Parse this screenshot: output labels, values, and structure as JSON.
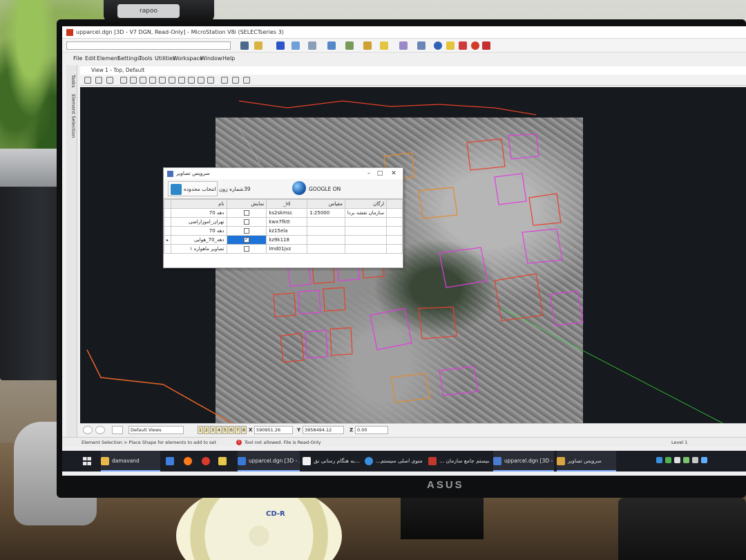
{
  "window": {
    "title": "upparcel.dgn [3D - V7 DGN, Read-Only] - MicroStation V8i (SELECTseries 3)"
  },
  "webcam": {
    "brand": "rapoo"
  },
  "menu": [
    "File",
    "Edit",
    "Element",
    "Settings",
    "Tools",
    "Utilities",
    "Workspace",
    "Window",
    "Help"
  ],
  "dock": {
    "tabs": [
      "Tasks",
      "Element Selection"
    ]
  },
  "view": {
    "title": "View 1 - Top, Default"
  },
  "dialog": {
    "title": "سرویس تصاویر",
    "select_button": "انتخاب محدوده",
    "zone_label": "شماره زون",
    "zone_value": "39",
    "google_label": "GOOGLE ON",
    "columns": [
      "نام",
      "نمایش",
      "_id",
      "مقیاس",
      "ارگان"
    ],
    "rows": [
      {
        "name": "دهه 70",
        "show": false,
        "id": "ks2skmsc",
        "scale": "1:25000",
        "org": "سازمان نقشه بردا",
        "selected": false
      },
      {
        "name": "تهران_اموزاراضی",
        "show": false,
        "id": "kwx7fktt",
        "scale": "",
        "org": "",
        "selected": false
      },
      {
        "name": "دهه 70",
        "show": false,
        "id": "kz15ela",
        "scale": "",
        "org": "",
        "selected": false
      },
      {
        "name": "دهه_70_هوایی",
        "show": true,
        "id": "kz9k118",
        "scale": "",
        "org": "",
        "selected": true
      },
      {
        "name": "تصاویر ماهواره ۱",
        "show": false,
        "id": "lmd01jvz",
        "scale": "",
        "org": "",
        "selected": false
      }
    ]
  },
  "viewbar": {
    "views_combo": "Default Views",
    "view_numbers": [
      "1",
      "2",
      "3",
      "4",
      "5",
      "6",
      "7",
      "8"
    ],
    "x_label": "X",
    "x_value": "590951.26",
    "y_label": "Y",
    "y_value": "3958494.12",
    "z_label": "Z",
    "z_value": "0.00"
  },
  "statusbar": {
    "prompt": "Element Selection > Place Shape for elements to add to set",
    "message": "Tool not allowed. File is Read-Only",
    "level": "Level 1"
  },
  "taskbar": {
    "items": [
      {
        "label": "damavand",
        "color": "#e8b84a"
      },
      {
        "label": "upparcel.dgn [3D - ...",
        "color": "#3a78d8"
      },
      {
        "label": "به هنگام رسانی نق...",
        "color": "#f0f0f0"
      },
      {
        "label": "...منوی اصلی سیستم",
        "color": "#3b8fe0"
      },
      {
        "label": "... سیستم جامع سازمان",
        "color": "#c0392b"
      },
      {
        "label": "upparcel.dgn [3D - ...",
        "color": "#4a7bd0"
      },
      {
        "label": "سرویس تصاویر",
        "color": "#d9a441"
      }
    ]
  },
  "monitor": {
    "brand": "ASUS"
  },
  "disc": {
    "label": "CD-R"
  },
  "colors": {
    "parcel_magenta": "#e03ce0",
    "parcel_red": "#e8402a",
    "parcel_orange": "#e38a2c",
    "selected_row": "#1e73d6",
    "canvas_bg": "#16191d"
  }
}
